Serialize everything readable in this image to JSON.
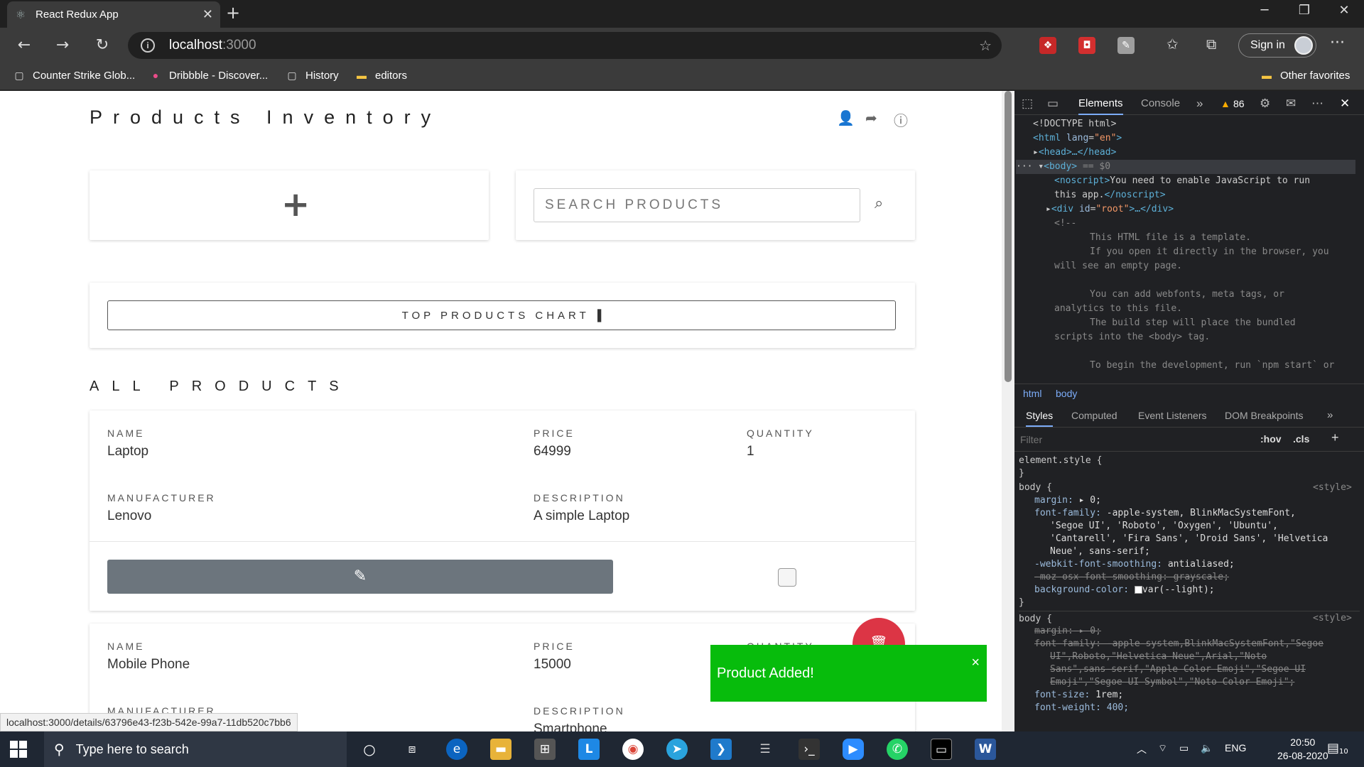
{
  "browser": {
    "tab_title": "React Redux App",
    "url_host": "localhost",
    "url_port": ":3000",
    "signin_label": "Sign in",
    "favorites": [
      {
        "label": "Counter Strike Glob...",
        "icon": "page-icon"
      },
      {
        "label": "Dribbble - Discover...",
        "icon": "dribbble-icon"
      },
      {
        "label": "History",
        "icon": "page-icon"
      },
      {
        "label": "editors",
        "icon": "folder-icon"
      }
    ],
    "other_favorites": "Other favorites",
    "status_url": "localhost:3000/details/63796e43-f23b-542e-99a7-11db520c7bb6"
  },
  "app": {
    "brand": "Products Inventory",
    "search_placeholder": "SEARCH PRODUCTS",
    "chart_button": "TOP PRODUCTS CHART",
    "section_title": "ALL PRODUCTS",
    "labels": {
      "name": "NAME",
      "price": "PRICE",
      "quantity": "QUANTITY",
      "manufacturer": "MANUFACTURER",
      "description": "DESCRIPTION"
    },
    "products": [
      {
        "name": "Laptop",
        "price": "64999",
        "quantity": "1",
        "manufacturer": "Lenovo",
        "description": "A simple Laptop"
      },
      {
        "name": "Mobile Phone",
        "price": "15000",
        "quantity": "",
        "manufacturer": "",
        "description": "Smartphone"
      }
    ],
    "toast": "Product Added!",
    "toast_close": "×",
    "accent_colors": {
      "toast": "#07bc0c",
      "delete": "#dc3545",
      "edit": "#6c757d"
    }
  },
  "devtools": {
    "tabs": {
      "elements": "Elements",
      "console": "Console"
    },
    "warning_count": "86",
    "breadcrumb": [
      "html",
      "body"
    ],
    "subtabs": [
      "Styles",
      "Computed",
      "Event Listeners",
      "DOM Breakpoints"
    ],
    "filter_placeholder": "Filter",
    "hov": ":hov",
    "cls": ".cls",
    "dom_lines": {
      "doctype": "<!DOCTYPE html>",
      "html_open_tag": "<html",
      "html_lang_attr": "lang",
      "html_lang_val": "\"en\"",
      "html_close": ">",
      "head": "<head>…</head>",
      "body": "<body>",
      "body_suffix": "== $0",
      "noscript_open": "<noscript>",
      "noscript_text_1": "You need to enable JavaScript to run",
      "noscript_text_2": "this app.",
      "noscript_close": "</noscript>",
      "div_open": "<div",
      "div_id_attr": "id",
      "div_id_val": "\"root\"",
      "div_rest": ">…</div>",
      "comment_open": "<!--",
      "c1": "This HTML file is a template.",
      "c2": "If you open it directly in the browser, you",
      "c3": "will see an empty page.",
      "c4": "You can add webfonts, meta tags, or",
      "c5": "analytics to this file.",
      "c6": "The build step will place the bundled",
      "c7": "scripts into the <body> tag.",
      "c8": "To begin the development, run `npm start` or"
    },
    "styles": {
      "element_style": "element.style {",
      "close_brace": "}",
      "body_selector": "body {",
      "source": "<style>",
      "margin": "margin:",
      "margin_val": "▸ 0;",
      "font_family": "font-family:",
      "ff_1": "-apple-system, BlinkMacSystemFont,",
      "ff_2": "'Segoe UI', 'Roboto', 'Oxygen', 'Ubuntu',",
      "ff_3": "'Cantarell', 'Fira Sans', 'Droid Sans', 'Helvetica",
      "ff_4": "Neue', sans-serif;",
      "webkit": "-webkit-font-smoothing:",
      "webkit_val": "antialiased;",
      "moz": "-moz-osx-font-smoothing: grayscale;",
      "bg": "background-color:",
      "bg_val": "var(--light);",
      "s2_ff_1": "font-family: -apple-system,BlinkMacSystemFont,\"Segoe",
      "s2_ff_2": "UI\",Roboto,\"Helvetica Neue\",Arial,\"Noto",
      "s2_ff_3": "Sans\",sans-serif,\"Apple Color Emoji\",\"Segoe UI",
      "s2_ff_4": "Emoji\",\"Segoe UI Symbol\",\"Noto Color Emoji\";",
      "font_size": "font-size:",
      "font_size_val": "1rem;",
      "font_weight": "font-weight: 400;"
    }
  },
  "taskbar": {
    "search_placeholder": "Type here to search",
    "lang": "ENG",
    "time": "20:50",
    "date": "26-08-2020",
    "notif_count": "10"
  }
}
